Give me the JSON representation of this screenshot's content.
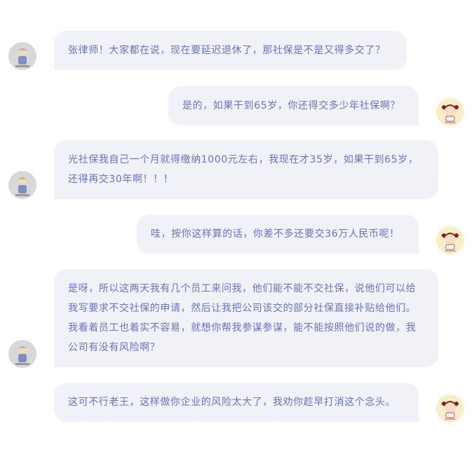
{
  "chat": {
    "messages": [
      {
        "side": "left",
        "avatar": "elderly-man-avatar-icon",
        "text": "张律师！大家都在说，现在要延迟退休了，那社保是不是又得多交了？"
      },
      {
        "side": "right",
        "avatar": "cartoon-girl-avatar-icon",
        "text": "是的，如果干到65岁，你还得交多少年社保啊？"
      },
      {
        "side": "left",
        "avatar": "elderly-man-avatar-icon",
        "text": "光社保我自己一个月就得缴纳1000元左右，我现在才35岁，如果干到65岁，还得再交30年啊！！！"
      },
      {
        "side": "right",
        "avatar": "cartoon-girl-avatar-icon",
        "text": "哇，按你这样算的话，你差不多还要交36万人民币呢！"
      },
      {
        "side": "left",
        "avatar": "elderly-man-avatar-icon",
        "text": "是呀，所以这两天我有几个员工来问我，他们能不能不交社保，说他们可以给我写要求不交社保的申请，然后让我把公司该交的部分社保直接补贴给他们。我看着员工也着实不容易，就想你帮我参谋参谋，能不能按照他们说的做，我公司有没有风险啊？"
      },
      {
        "side": "right",
        "avatar": "cartoon-girl-avatar-icon",
        "text": "这可不行老王，这样做你企业的风险太大了，我劝你趁早打消这个念头。"
      }
    ],
    "colors": {
      "bubble_bg": "#f0f2f8",
      "text": "#6a72c8",
      "lawyer_avatar_bg": "#d8d8d8",
      "client_avatar_bg": "#f6efc8"
    }
  }
}
